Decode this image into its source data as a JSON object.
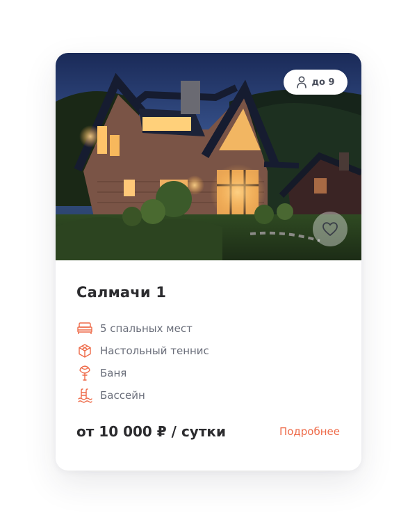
{
  "card": {
    "title": "Салмачи 1",
    "guests": {
      "icon": "person-icon",
      "label": "до 9"
    },
    "favorite": {
      "icon": "heart-icon"
    },
    "features": [
      {
        "icon": "bed-icon",
        "label": "5 спальных мест"
      },
      {
        "icon": "ping-pong-icon",
        "label": "Настольный теннис"
      },
      {
        "icon": "birch-broom-icon",
        "label": "Баня"
      },
      {
        "icon": "pool-icon",
        "label": "Бассейн"
      }
    ],
    "price": "от 10 000 ₽ / сутки",
    "more_label": "Подробнее"
  },
  "colors": {
    "accent": "#ee6a48",
    "title": "#2b2b2e",
    "muted": "#6a6e7a"
  }
}
